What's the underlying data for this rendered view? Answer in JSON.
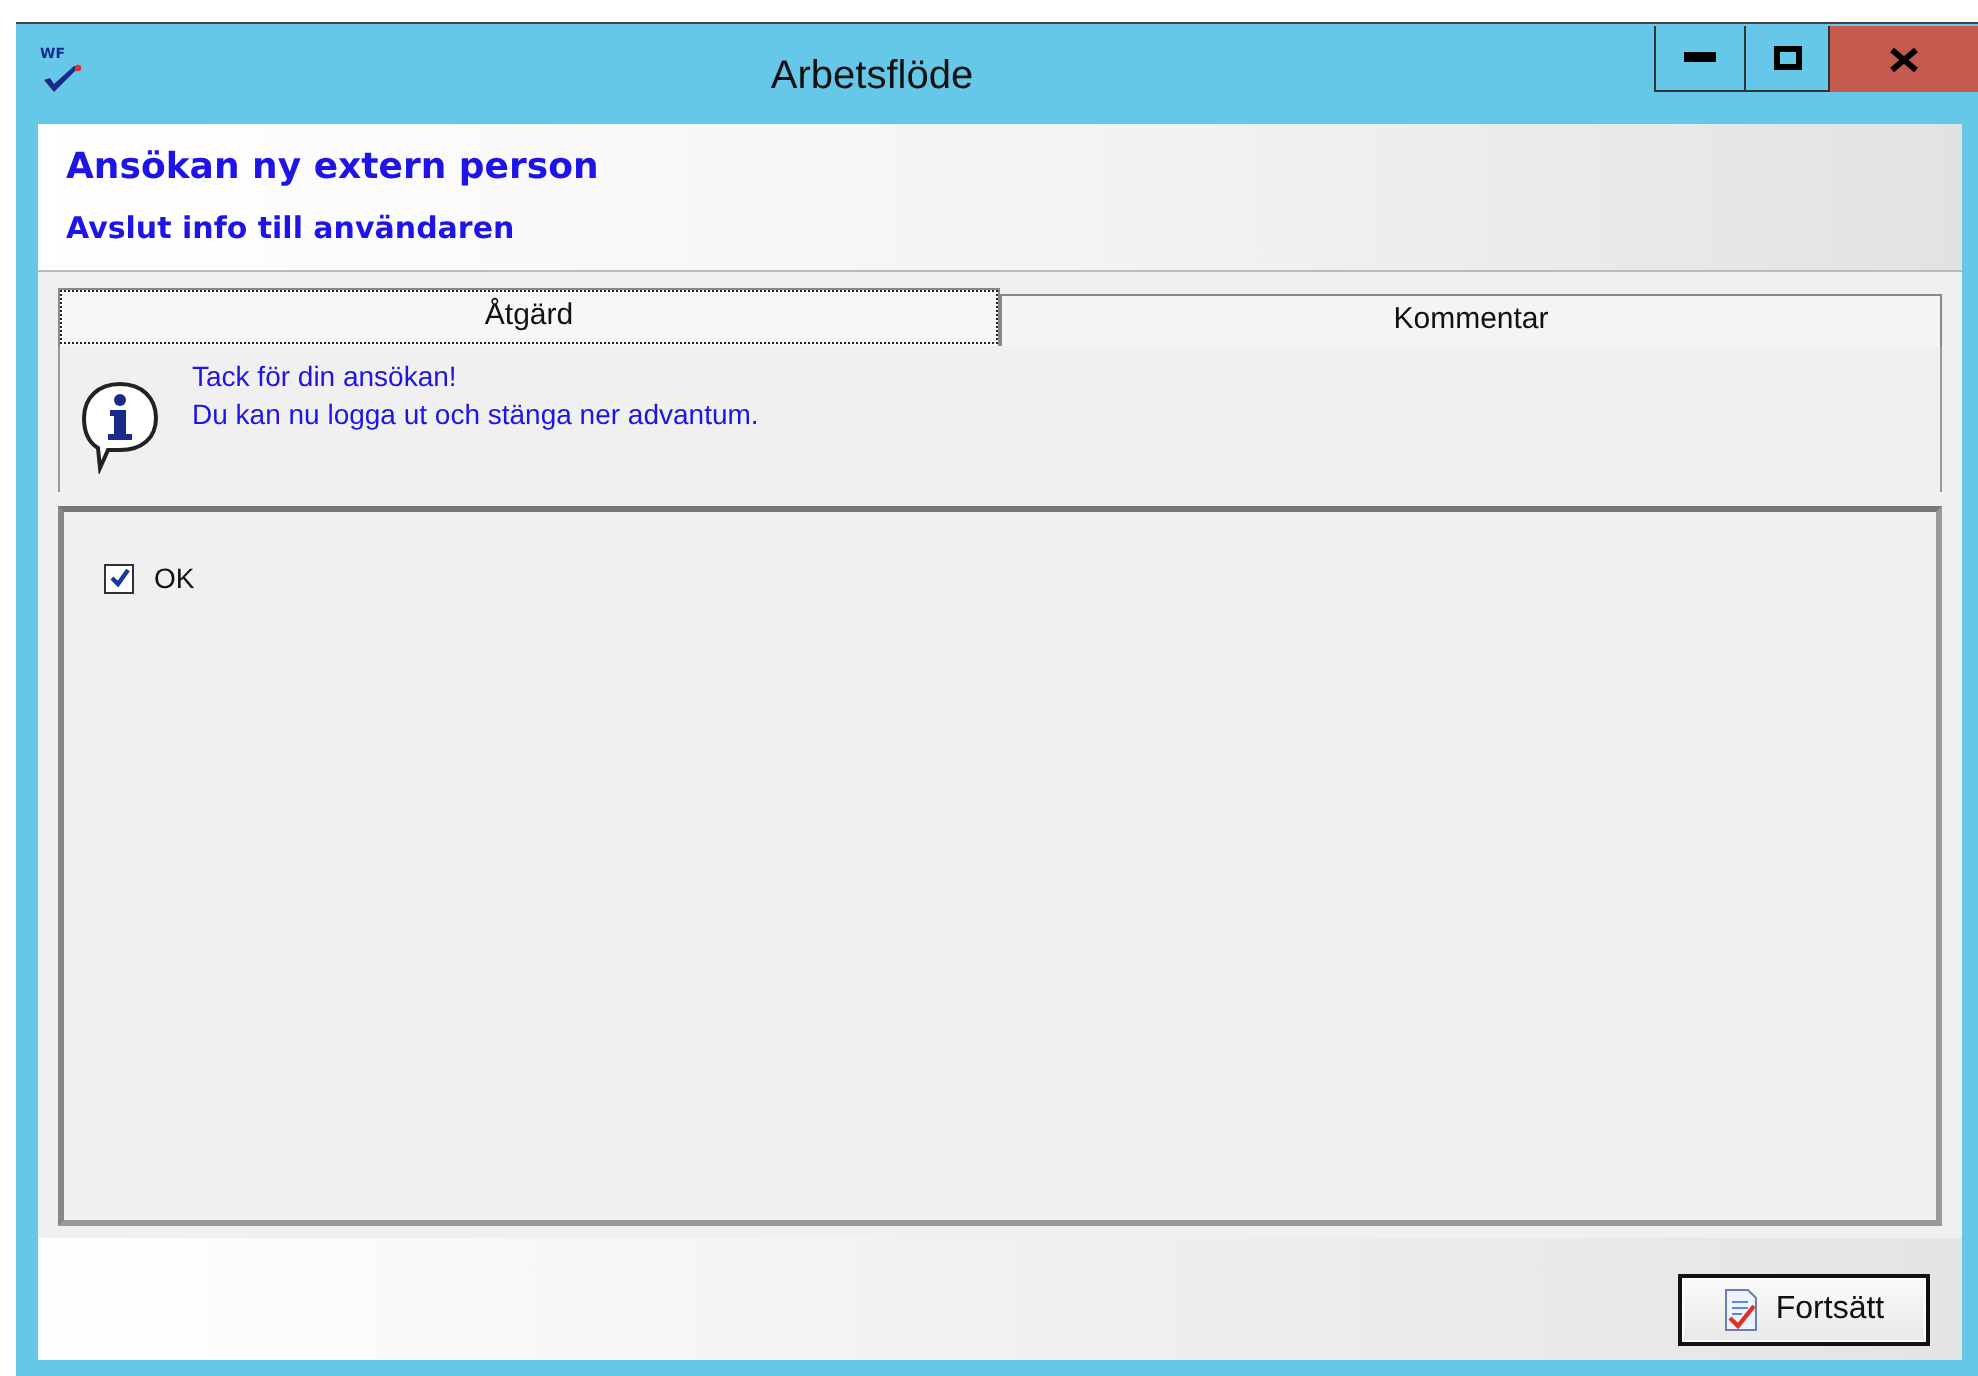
{
  "window": {
    "title": "Arbetsflöde",
    "icon_text": "WF",
    "controls": [
      {
        "kind": "minimize"
      },
      {
        "kind": "maximize"
      },
      {
        "kind": "close"
      }
    ]
  },
  "header": {
    "title": "Ansökan ny extern person",
    "subtitle": "Avslut info till användaren"
  },
  "tabs": [
    {
      "label": "Åtgärd",
      "selected": true
    },
    {
      "label": "Kommentar",
      "selected": false
    }
  ],
  "info": {
    "lines": [
      "Tack för din ansökan!",
      "Du kan nu logga ut och stänga ner advantum."
    ]
  },
  "options": [
    {
      "label": "OK",
      "checked": true
    }
  ],
  "buttons": [
    {
      "label": "Fortsätt"
    }
  ]
}
